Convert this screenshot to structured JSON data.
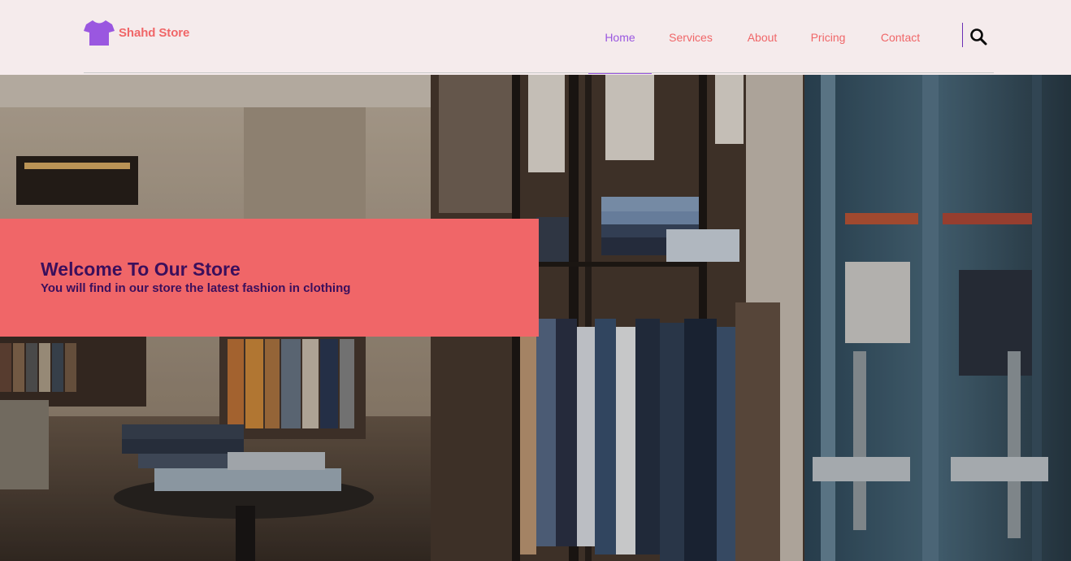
{
  "brand": {
    "name": "Shahd Store",
    "logo_icon": "tshirt-icon",
    "color": "#f06668",
    "icon_color": "#9a57e0"
  },
  "nav": {
    "items": [
      {
        "label": "Home",
        "active": true
      },
      {
        "label": "Services",
        "active": false
      },
      {
        "label": "About",
        "active": false
      },
      {
        "label": "Pricing",
        "active": false
      },
      {
        "label": "Contact",
        "active": false
      }
    ],
    "active_color": "#9a57e0",
    "link_color": "#f06668",
    "search_icon": "search-icon"
  },
  "hero": {
    "title": "Welcome To Our Store",
    "subtitle": "You will find in our store the latest fashion in clothing",
    "banner_color": "#f06668",
    "text_color": "#3b0f5c"
  }
}
